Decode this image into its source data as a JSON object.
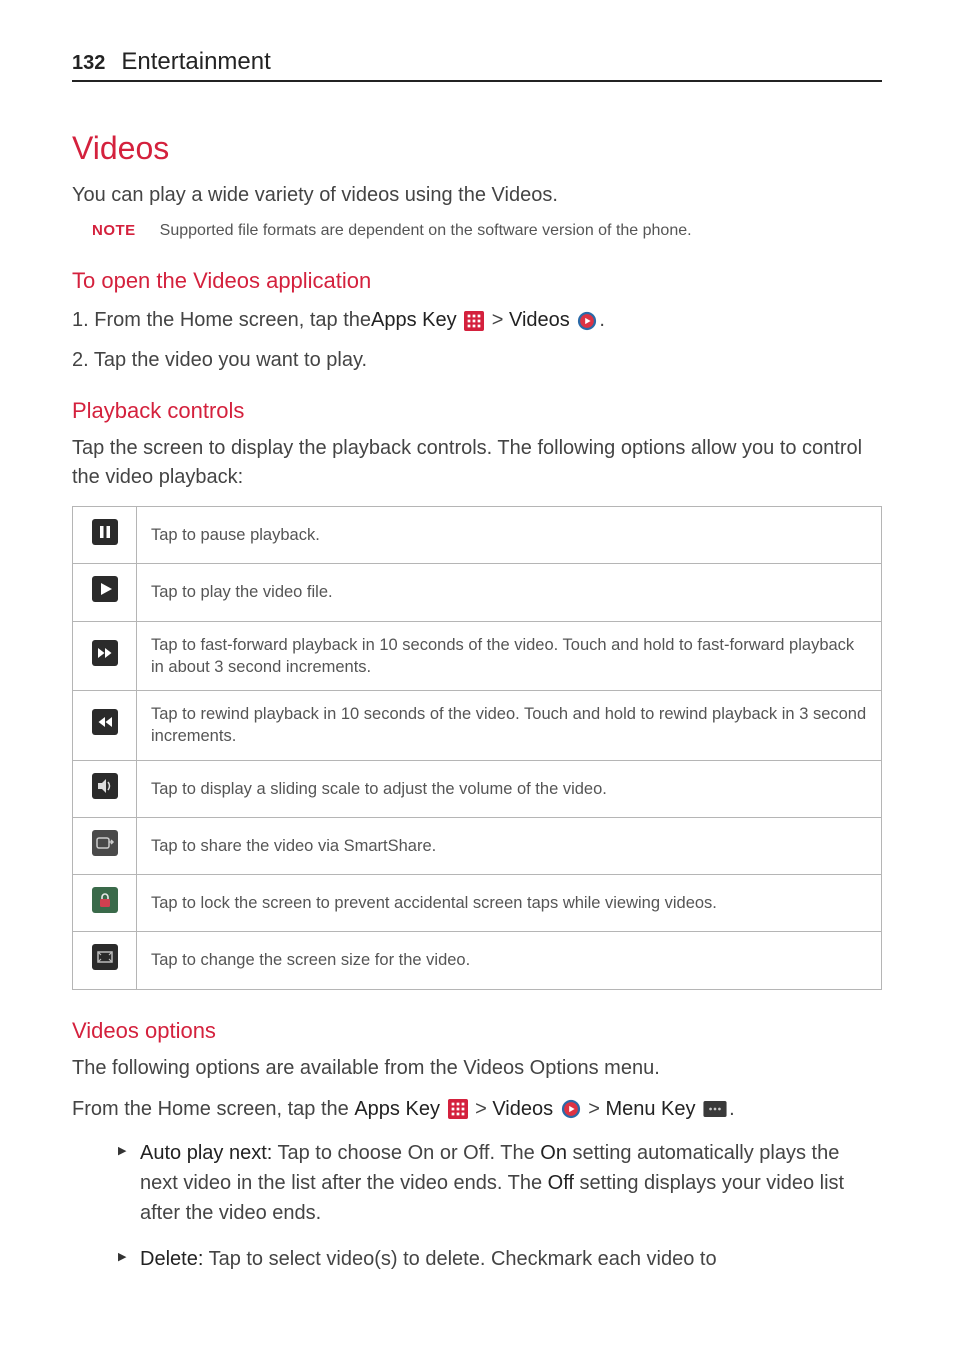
{
  "header": {
    "page_number": "132",
    "section": "Entertainment"
  },
  "title": "Videos",
  "intro": "You can play a wide variety of videos using the Videos.",
  "note": {
    "label": "NOTE",
    "text": "Supported file formats are dependent on the software version of the phone."
  },
  "open_section": {
    "heading": "To open the Videos application",
    "steps": {
      "s1_prefix": "1.  From the Home screen, tap the ",
      "s1_apps_key": "Apps Key",
      "s1_gt1": " > ",
      "s1_videos": "Videos",
      "s1_period": ".",
      "s2": "2.  Tap the video you want to play."
    }
  },
  "playback": {
    "heading": "Playback controls",
    "intro": "Tap the screen to display the playback controls. The following options allow you to control the video playback:",
    "rows": [
      {
        "icon": "pause-icon",
        "text": "Tap to pause playback."
      },
      {
        "icon": "play-icon",
        "text": "Tap to play the video file."
      },
      {
        "icon": "ff-icon",
        "text": "Tap to fast-forward playback in 10 seconds of the video. Touch and hold to fast-forward playback in about 3 second increments."
      },
      {
        "icon": "rw-icon",
        "text": "Tap to rewind playback in 10 seconds of the video. Touch and hold to rewind playback in 3 second increments."
      },
      {
        "icon": "volume-icon",
        "text": "Tap to display a sliding scale to adjust the volume of the video."
      },
      {
        "icon": "smartshare-icon",
        "text": "Tap to share the video via SmartShare."
      },
      {
        "icon": "lock-icon",
        "text": "Tap to lock the screen to prevent accidental screen taps while viewing videos."
      },
      {
        "icon": "screensize-icon",
        "text": "Tap to change the screen size for the video."
      }
    ]
  },
  "options": {
    "heading": "Videos options",
    "intro": "The following options are available from the Videos Options menu.",
    "path_prefix": "From the Home screen, tap the ",
    "apps_key": "Apps Key",
    "gt1": " > ",
    "videos": "Videos",
    "gt2": " > ",
    "menu_key": "Menu Key",
    "period": ".",
    "bullets": {
      "b1_label": "Auto play next:",
      "b1_text_a": " Tap to choose On or Off. The ",
      "b1_on": "On",
      "b1_text_b": " setting automatically plays the next video in the list after the video ends. The ",
      "b1_off": "Off",
      "b1_text_c": " setting displays your video list after the video ends.",
      "b2_label": "Delete:",
      "b2_text": " Tap to select video(s) to delete. Checkmark each video to"
    }
  }
}
